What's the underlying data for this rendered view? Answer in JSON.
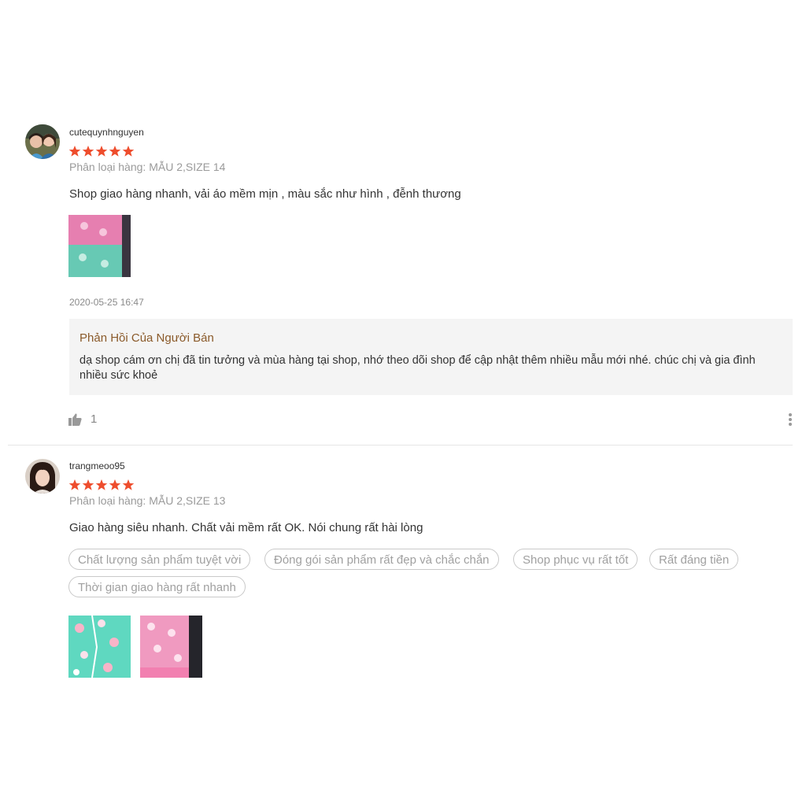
{
  "reviews": [
    {
      "author": "cutequynhnguyen",
      "rating": 5,
      "variation": "Phân loại hàng: MẪU 2,SIZE 14",
      "comment": "Shop giao hàng nhanh, vải áo mềm mịn , màu sắc như hình , đễnh thương",
      "timestamp": "2020-05-25 16:47",
      "seller_reply": {
        "title": "Phản Hồi Của Người Bán",
        "text": "dạ shop cám ơn chị đã tin tưởng và mùa hàng tại shop, nhớ theo dõi shop để cập nhật thêm nhiều mẫu mới nhé. chúc chị và gia đình nhiều sức khoẻ"
      },
      "likes": "1"
    },
    {
      "author": "trangmeoo95",
      "rating": 5,
      "variation": "Phân loại hàng: MẪU 2,SIZE 13",
      "comment": "Giao hàng siêu nhanh. Chất vải mềm rất OK. Nói chung rất hài lòng",
      "tags": [
        "Chất lượng sản phẩm tuyệt vời",
        "Đóng gói sản phẩm rất đẹp và chắc chắn",
        "Shop phục vụ rất tốt",
        "Rất đáng tiền",
        "Thời gian giao hàng rất nhanh"
      ]
    }
  ],
  "icons": {
    "star": "star-icon",
    "like": "thumbs-up-icon",
    "more": "more-vertical-icon"
  },
  "colors": {
    "star": "#ee4d2d",
    "reply_title": "#8a5a2a",
    "reply_bg": "#f4f4f4"
  }
}
